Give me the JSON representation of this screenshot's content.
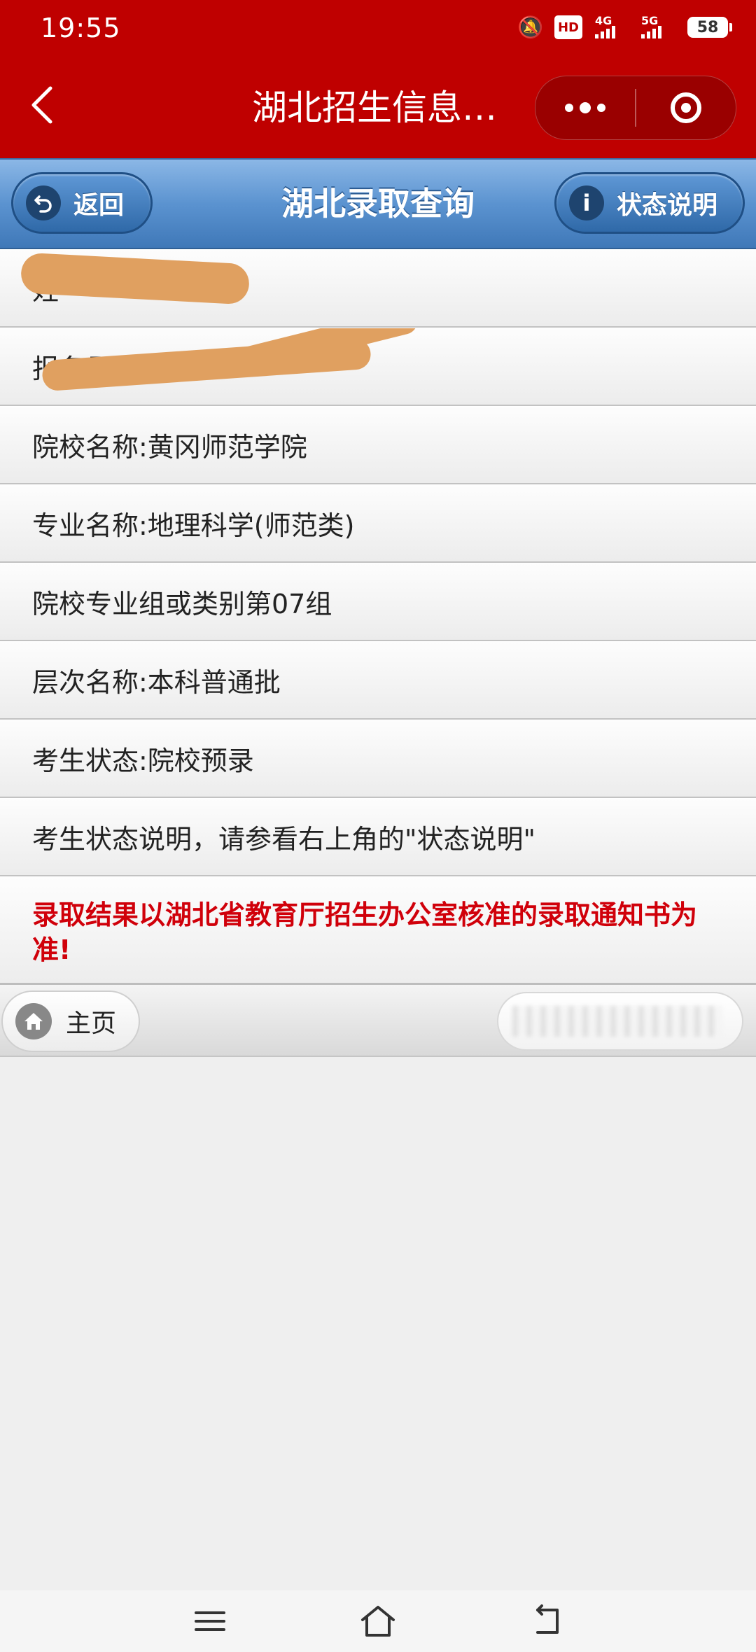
{
  "status_bar": {
    "time": "19:55",
    "hd_label": "HD",
    "net_label_1": "4G",
    "net_label_2": "5G",
    "battery": "58"
  },
  "mini_program": {
    "title": "湖北招生信息…"
  },
  "page_header": {
    "title": "湖北录取查询",
    "back_label": "返回",
    "status_label": "状态说明"
  },
  "rows": [
    {
      "text": "姓"
    },
    {
      "text": "报名号"
    },
    {
      "text": "院校名称:黄冈师范学院"
    },
    {
      "text": "专业名称:地理科学(师范类)"
    },
    {
      "text": "院校专业组或类别第07组"
    },
    {
      "text": "层次名称:本科普通批"
    },
    {
      "text": "考生状态:院校预录"
    },
    {
      "text": "考生状态说明，请参看右上角的\"状态说明\""
    }
  ],
  "notice": "录取结果以湖北省教育厅招生办公室核准的录取通知书为准!",
  "footer": {
    "home_label": "主页"
  },
  "colors": {
    "topbar": "#bf0000",
    "header_blue": "#5b93d0",
    "notice_red": "#d0000a",
    "redaction": "#e0a060"
  }
}
